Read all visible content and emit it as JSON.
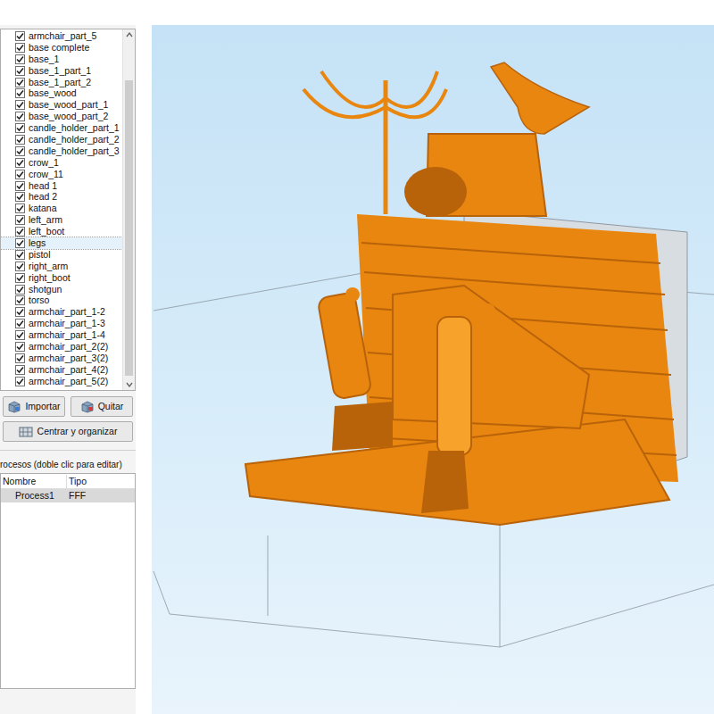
{
  "object_list": {
    "items": [
      {
        "label": "armchair_part_5",
        "checked": true,
        "selected": false
      },
      {
        "label": "base complete",
        "checked": true,
        "selected": false
      },
      {
        "label": "base_1",
        "checked": true,
        "selected": false
      },
      {
        "label": "base_1_part_1",
        "checked": true,
        "selected": false
      },
      {
        "label": "base_1_part_2",
        "checked": true,
        "selected": false
      },
      {
        "label": "base_wood",
        "checked": true,
        "selected": false
      },
      {
        "label": "base_wood_part_1",
        "checked": true,
        "selected": false
      },
      {
        "label": "base_wood_part_2",
        "checked": true,
        "selected": false
      },
      {
        "label": "candle_holder_part_1",
        "checked": true,
        "selected": false
      },
      {
        "label": "candle_holder_part_2",
        "checked": true,
        "selected": false
      },
      {
        "label": "candle_holder_part_3",
        "checked": true,
        "selected": false
      },
      {
        "label": "crow_1",
        "checked": true,
        "selected": false
      },
      {
        "label": "crow_11",
        "checked": true,
        "selected": false
      },
      {
        "label": "head 1",
        "checked": true,
        "selected": false
      },
      {
        "label": "head 2",
        "checked": true,
        "selected": false
      },
      {
        "label": "katana",
        "checked": true,
        "selected": false
      },
      {
        "label": "left_arm",
        "checked": true,
        "selected": false
      },
      {
        "label": "left_boot",
        "checked": true,
        "selected": false
      },
      {
        "label": "legs",
        "checked": true,
        "selected": true
      },
      {
        "label": "pistol",
        "checked": true,
        "selected": false
      },
      {
        "label": "right_arm",
        "checked": true,
        "selected": false
      },
      {
        "label": "right_boot",
        "checked": true,
        "selected": false
      },
      {
        "label": "shotgun",
        "checked": true,
        "selected": false
      },
      {
        "label": "torso",
        "checked": true,
        "selected": false
      },
      {
        "label": "armchair_part_1-2",
        "checked": true,
        "selected": false
      },
      {
        "label": "armchair_part_1-3",
        "checked": true,
        "selected": false
      },
      {
        "label": "armchair_part_1-4",
        "checked": true,
        "selected": false
      },
      {
        "label": "armchair_part_2(2)",
        "checked": true,
        "selected": false
      },
      {
        "label": "armchair_part_3(2)",
        "checked": true,
        "selected": false
      },
      {
        "label": "armchair_part_4(2)",
        "checked": true,
        "selected": false
      },
      {
        "label": "armchair_part_5(2)",
        "checked": true,
        "selected": false
      }
    ]
  },
  "buttons": [
    {
      "label": "Importar"
    },
    {
      "label": "Quitar"
    },
    {
      "label": "Centrar y organizar"
    }
  ],
  "processes": {
    "title": "rocesos (doble clic para editar)",
    "columns": [
      "Nombre",
      "Tipo"
    ],
    "rows": [
      {
        "cells": [
          "Process1",
          "FFF"
        ],
        "selected": true
      }
    ]
  }
}
